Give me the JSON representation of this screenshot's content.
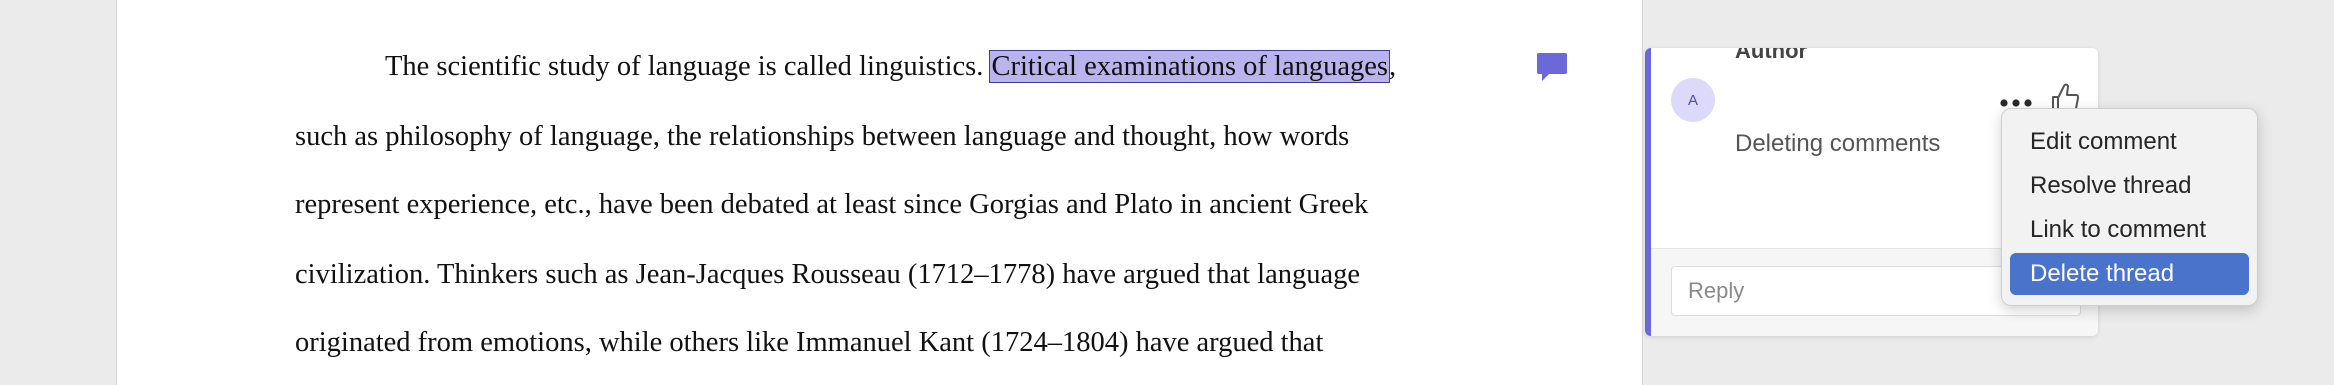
{
  "document": {
    "line1_before": "The scientific study of language is called linguistics. ",
    "line1_highlight": "Critical examinations of languages",
    "line1_after": ",",
    "line2": "such as philosophy of language, the relationships between language and thought, how words",
    "line3": "represent experience, etc., have been debated at least since Gorgias and Plato in ancient Greek",
    "line4": "civilization. Thinkers such as Jean-Jacques Rousseau (1712–1778) have argued that language",
    "line5": "originated from emotions, while others like Immanuel Kant (1724–1804) have argued that"
  },
  "comment": {
    "avatar_initial": "A",
    "author": "Author",
    "text": "Deleting comments",
    "reply_placeholder": "Reply"
  },
  "context_menu": {
    "items": [
      {
        "label": "Edit comment"
      },
      {
        "label": "Resolve thread"
      },
      {
        "label": "Link to comment"
      },
      {
        "label": "Delete thread"
      }
    ],
    "active_index": 3
  },
  "icons": {
    "comment_marker": "comment-bubble-icon",
    "more": "more-options-icon",
    "like": "thumbs-up-icon"
  },
  "colors": {
    "accent": "#6b68d8",
    "highlight": "#b9b4ee",
    "menu_active": "#4a74cc"
  }
}
